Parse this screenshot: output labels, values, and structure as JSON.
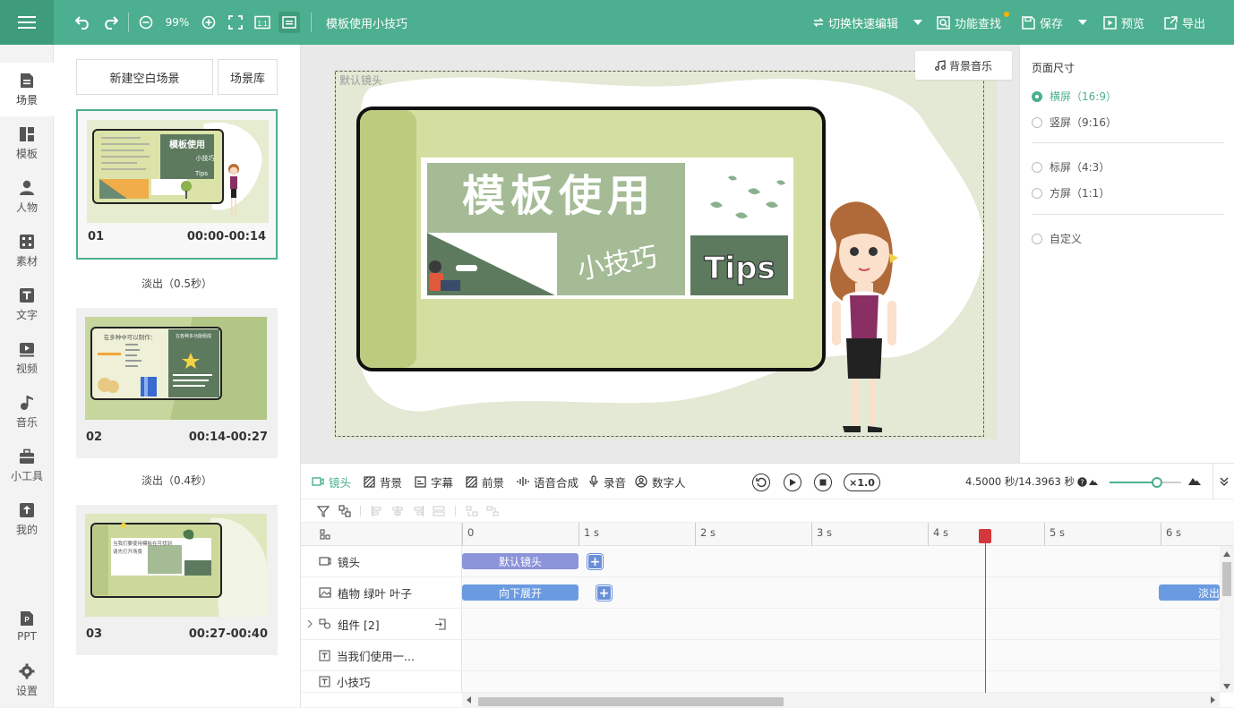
{
  "toolbar": {
    "zoom": "99%",
    "title": "模板使用小技巧",
    "quick_edit": "切换快速编辑",
    "feature_search": "功能查找",
    "save": "保存",
    "preview": "预览",
    "export": "导出"
  },
  "leftnav": {
    "items": [
      {
        "label": "场景",
        "icon": "scene-icon"
      },
      {
        "label": "模板",
        "icon": "template-icon"
      },
      {
        "label": "人物",
        "icon": "person-icon"
      },
      {
        "label": "素材",
        "icon": "material-icon"
      },
      {
        "label": "文字",
        "icon": "text-icon"
      },
      {
        "label": "视频",
        "icon": "video-icon"
      },
      {
        "label": "音乐",
        "icon": "music-icon"
      },
      {
        "label": "小工具",
        "icon": "toolbox-icon"
      },
      {
        "label": "我的",
        "icon": "upload-icon"
      },
      {
        "label": "PPT",
        "icon": "ppt-icon"
      },
      {
        "label": "设置",
        "icon": "gear-icon"
      }
    ]
  },
  "scenes": {
    "new_blank": "新建空白场景",
    "library": "场景库",
    "list": [
      {
        "num": "01",
        "time": "00:00-00:14",
        "transition": "淡出（0.5秒）"
      },
      {
        "num": "02",
        "time": "00:14-00:27",
        "transition": "淡出（0.4秒）"
      },
      {
        "num": "03",
        "time": "00:27-00:40"
      }
    ],
    "thumb1": {
      "title": "模板使用",
      "sub": "小技巧",
      "tips": "Tips"
    },
    "thumb2": {
      "head": "在多种中可以制作：",
      "right": "在各种多功能组成"
    },
    "thumb3": {
      "line1": "当我们要使用模板在可找到",
      "line2": "请先打开场景"
    }
  },
  "canvas": {
    "bg_music": "背景音乐",
    "camera_label": "默认镜头",
    "title_text": "模板使用",
    "sub_text": "小技巧",
    "tips_text": "Tips"
  },
  "page_size": {
    "title": "页面尺寸",
    "options": [
      {
        "label": "横屏（16:9）",
        "selected": true
      },
      {
        "label": "竖屏（9:16）",
        "selected": false
      },
      {
        "label": "标屏（4:3）",
        "selected": false
      },
      {
        "label": "方屏（1:1）",
        "selected": false
      },
      {
        "label": "自定义",
        "selected": false
      }
    ]
  },
  "timeline": {
    "tools": [
      {
        "label": "镜头",
        "icon": "camera-icon",
        "active": true
      },
      {
        "label": "背景",
        "icon": "background-icon",
        "active": false
      },
      {
        "label": "字幕",
        "icon": "subtitle-icon",
        "active": false
      },
      {
        "label": "前景",
        "icon": "foreground-icon",
        "active": false
      },
      {
        "label": "语音合成",
        "icon": "voice-synthesis-icon",
        "active": false
      },
      {
        "label": "录音",
        "icon": "microphone-icon",
        "active": false
      },
      {
        "label": "数字人",
        "icon": "digital-human-icon",
        "active": false
      }
    ],
    "speed": "×1.0",
    "timecode": "4.5000 秒/14.3963 秒",
    "zoom_level": 0.66,
    "ruler": [
      "0",
      "1 s",
      "2 s",
      "3 s",
      "4 s",
      "5 s",
      "6 s"
    ],
    "tracks": [
      {
        "label": "镜头",
        "icon": "camera-track-icon"
      },
      {
        "label": "植物 绿叶 叶子",
        "icon": "image-track-icon"
      },
      {
        "label": "组件 [2]",
        "icon": "group-track-icon"
      },
      {
        "label": "当我们使用一...",
        "icon": "text-track-icon"
      },
      {
        "label": "小技巧",
        "icon": "text-track-icon"
      }
    ],
    "clips": {
      "camera": "默认镜头",
      "plant_in": "向下展开",
      "plant_out": "淡出"
    },
    "colors": {
      "camera_clip": "#8b93d9",
      "anim_clip": "#6a9be0",
      "accent": "#4caf8f"
    }
  }
}
